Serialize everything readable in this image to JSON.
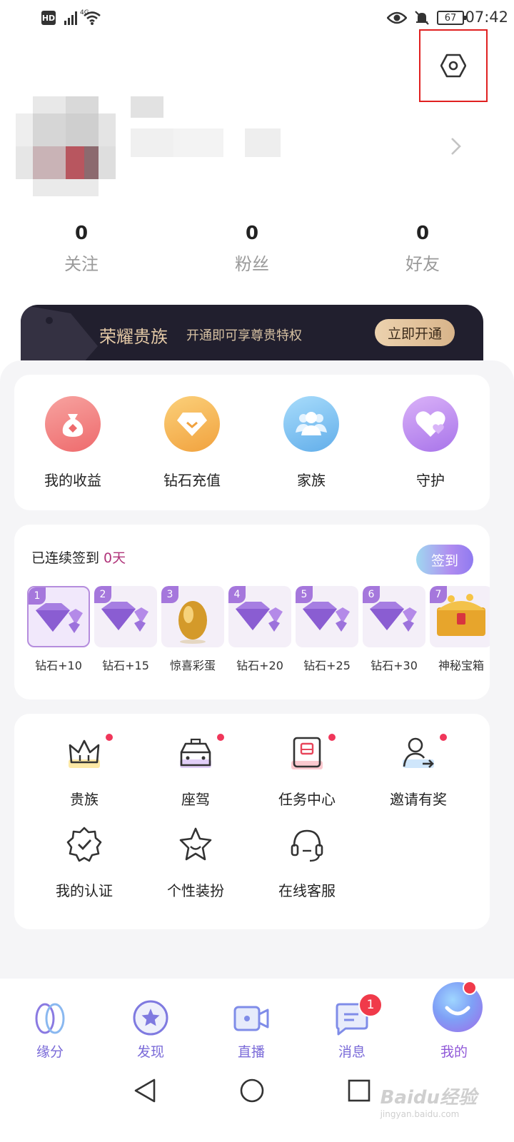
{
  "status_bar": {
    "hd": "HD",
    "network": "4G",
    "battery": "67",
    "time": "07:42"
  },
  "profile": {
    "stats": [
      {
        "value": "0",
        "label": "关注"
      },
      {
        "value": "0",
        "label": "粉丝"
      },
      {
        "value": "0",
        "label": "好友"
      }
    ]
  },
  "noble_banner": {
    "title": "荣耀贵族",
    "subtitle": "开通即可享尊贵特权",
    "button": "立即开通"
  },
  "quick_actions": [
    {
      "label": "我的收益",
      "icon": "money-bag-icon",
      "color": "#f0787a"
    },
    {
      "label": "钻石充值",
      "icon": "diamond-icon",
      "color": "#f5b24e"
    },
    {
      "label": "家族",
      "icon": "group-icon",
      "color": "#7cc4f2"
    },
    {
      "label": "守护",
      "icon": "heart-icon",
      "color": "#c08cf0"
    }
  ],
  "checkin": {
    "title_prefix": "已连续签到 ",
    "days_count": "0天",
    "button": "签到",
    "days": [
      {
        "num": "1",
        "label": "钻石+10",
        "reward": "diamond"
      },
      {
        "num": "2",
        "label": "钻石+15",
        "reward": "diamond"
      },
      {
        "num": "3",
        "label": "惊喜彩蛋",
        "reward": "egg"
      },
      {
        "num": "4",
        "label": "钻石+20",
        "reward": "diamond"
      },
      {
        "num": "5",
        "label": "钻石+25",
        "reward": "diamond"
      },
      {
        "num": "6",
        "label": "钻石+30",
        "reward": "diamond"
      },
      {
        "num": "7",
        "label": "神秘宝箱",
        "reward": "chest"
      }
    ]
  },
  "features": [
    {
      "label": "贵族",
      "icon": "crown-icon",
      "dot": true
    },
    {
      "label": "座驾",
      "icon": "car-icon",
      "dot": true
    },
    {
      "label": "任务中心",
      "icon": "task-icon",
      "dot": true
    },
    {
      "label": "邀请有奖",
      "icon": "invite-icon",
      "dot": true
    },
    {
      "label": "我的认证",
      "icon": "verified-badge-icon",
      "dot": false
    },
    {
      "label": "个性装扮",
      "icon": "star-face-icon",
      "dot": false
    },
    {
      "label": "在线客服",
      "icon": "headset-icon",
      "dot": false
    }
  ],
  "tab_bar": [
    {
      "label": "缘分",
      "icon": "fate-icon"
    },
    {
      "label": "发现",
      "icon": "discover-icon"
    },
    {
      "label": "直播",
      "icon": "live-camera-icon"
    },
    {
      "label": "消息",
      "icon": "message-icon",
      "badge": "1"
    },
    {
      "label": "我的",
      "icon": "me-avatar-icon",
      "active": true
    }
  ],
  "watermark": {
    "brand": "Baidu经验",
    "url": "jingyan.baidu.com"
  }
}
